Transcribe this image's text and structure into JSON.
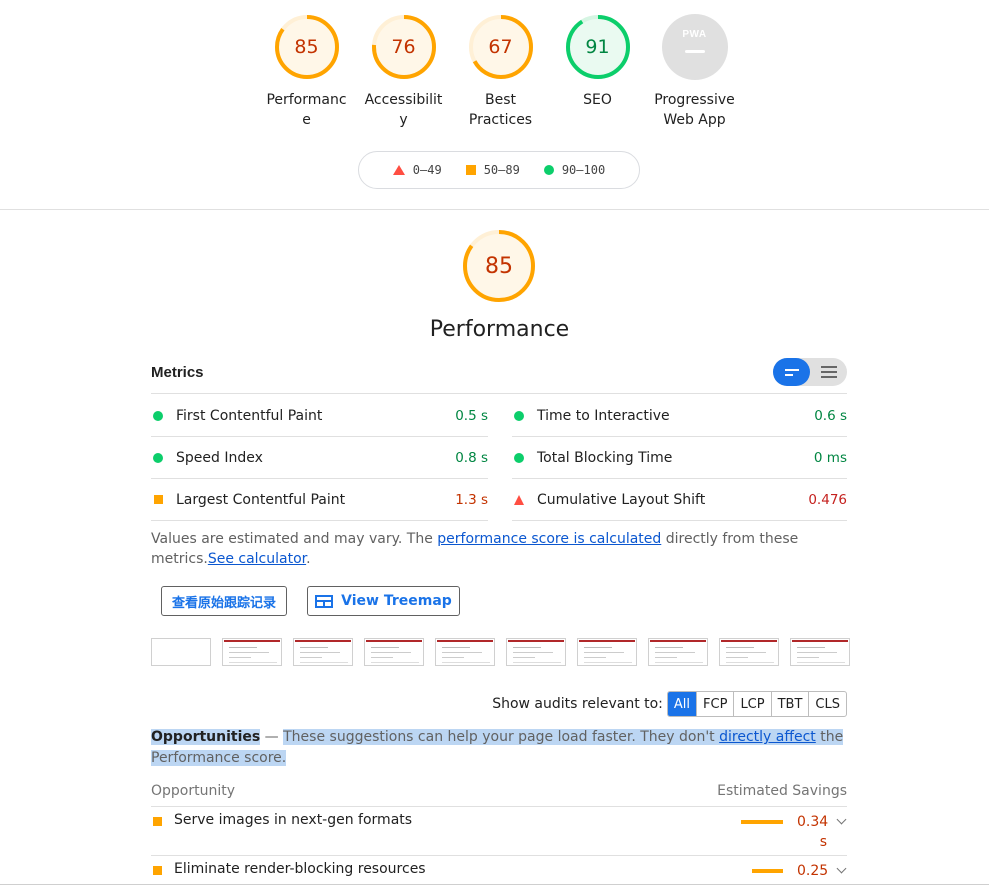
{
  "categories": [
    {
      "score": "85",
      "label": "Performance",
      "color": "#ffa400",
      "fraction": 0.85
    },
    {
      "score": "76",
      "label": "Accessibility",
      "color": "#ffa400",
      "fraction": 0.76
    },
    {
      "score": "67",
      "label": "Best Practices",
      "color": "#ffa400",
      "fraction": 0.67
    },
    {
      "score": "91",
      "label": "SEO",
      "color": "#0cce6b",
      "fraction": 0.91
    },
    {
      "score": "",
      "label": "Progressive Web App",
      "badge": "PWA"
    }
  ],
  "legend": {
    "fail": "0–49",
    "average": "50–89",
    "pass": "90–100"
  },
  "performance": {
    "score": "85",
    "title": "Performance",
    "fraction": 0.85
  },
  "metrics": {
    "title": "Metrics",
    "left": [
      {
        "name": "First Contentful Paint",
        "value": "0.5 s",
        "status": "pass"
      },
      {
        "name": "Speed Index",
        "value": "0.8 s",
        "status": "pass"
      },
      {
        "name": "Largest Contentful Paint",
        "value": "1.3 s",
        "status": "average"
      }
    ],
    "right": [
      {
        "name": "Time to Interactive",
        "value": "0.6 s",
        "status": "pass"
      },
      {
        "name": "Total Blocking Time",
        "value": "0 ms",
        "status": "pass"
      },
      {
        "name": "Cumulative Layout Shift",
        "value": "0.476",
        "status": "fail"
      }
    ]
  },
  "note": {
    "prefix": "Values are estimated and may vary. The ",
    "link": "performance score is calculated",
    "middle": " directly from these metrics.",
    "link2": "See calculator",
    "suffix": "."
  },
  "buttons": {
    "trace": "查看原始跟踪记录",
    "treemap": "View Treemap"
  },
  "filter": {
    "label": "Show audits relevant to:",
    "options": [
      "All",
      "FCP",
      "LCP",
      "TBT",
      "CLS"
    ],
    "active": "All"
  },
  "opportunities": {
    "title": "Opportunities",
    "dash": " — ",
    "desc_a": "These suggestions can help your page load faster. They don't ",
    "desc_link": "directly affect",
    "desc_b": " the Performance score.",
    "col_left": "Opportunity",
    "col_right": "Estimated Savings",
    "items": [
      {
        "name": "Serve images in next-gen formats",
        "value": "0.34 s",
        "savings": 0.34
      },
      {
        "name": "Eliminate render-blocking resources",
        "value": "0.25",
        "savings": 0.25
      }
    ]
  }
}
